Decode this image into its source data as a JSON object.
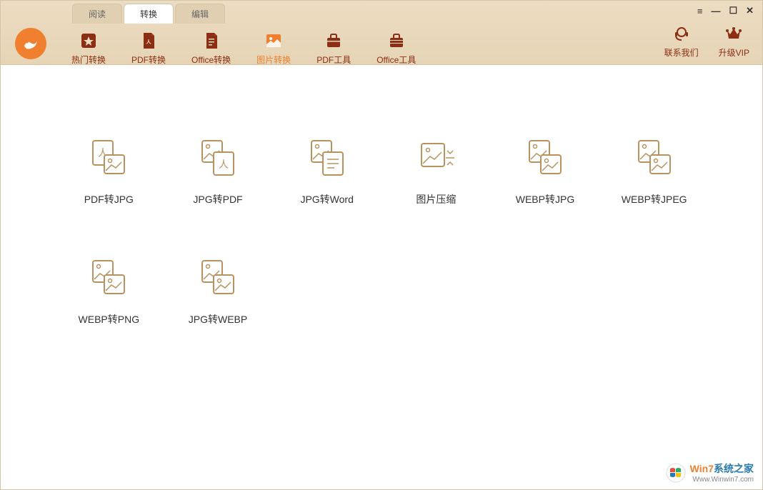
{
  "tabs": {
    "read": "阅读",
    "convert": "转换",
    "edit": "编辑"
  },
  "nav": {
    "hot": "热门转换",
    "pdf": "PDF转换",
    "office": "Office转换",
    "image": "图片转换",
    "pdftools": "PDF工具",
    "officetools": "Office工具"
  },
  "actions": {
    "contact": "联系我们",
    "upgrade": "升级VIP"
  },
  "items": {
    "pdf_to_jpg": "PDF转JPG",
    "jpg_to_pdf": "JPG转PDF",
    "jpg_to_word": "JPG转Word",
    "img_compress": "图片压缩",
    "webp_to_jpg": "WEBP转JPG",
    "webp_to_jpeg": "WEBP转JPEG",
    "webp_to_png": "WEBP转PNG",
    "jpg_to_webp": "JPG转WEBP"
  },
  "watermark": {
    "brand_left": "Win7",
    "brand_right": "系统之家",
    "url": "Www.Winwin7.com"
  }
}
